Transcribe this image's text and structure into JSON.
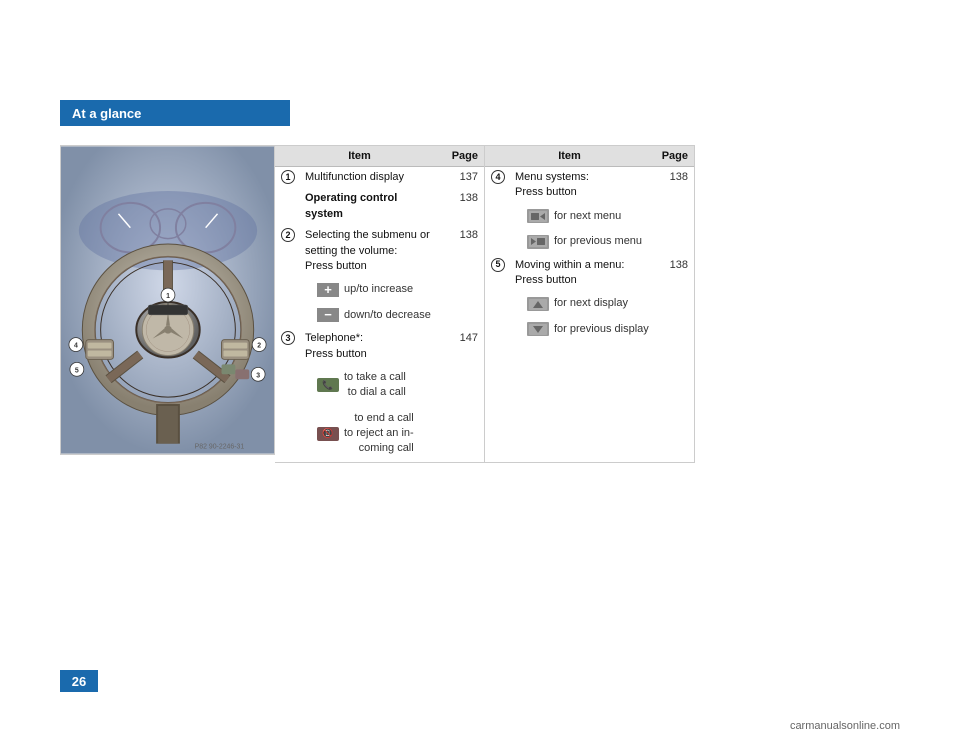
{
  "header": {
    "label": "At a glance"
  },
  "page_number": "26",
  "watermark": "carmanualsonline.com",
  "image_ref": "P82 90-2246-31",
  "left_table": {
    "col_item": "Item",
    "col_page": "Page",
    "rows": [
      {
        "num": "1",
        "label": "Multifunction display",
        "bold": false,
        "page": "137"
      },
      {
        "num": "",
        "label": "Operating control system",
        "bold": true,
        "page": "138"
      },
      {
        "num": "2",
        "label": "Selecting the submenu or setting the volume: Press button",
        "bold": false,
        "page": "138",
        "icons": [
          {
            "type": "plus",
            "label": "up/to increase"
          },
          {
            "type": "minus",
            "label": "down/to decrease"
          }
        ]
      },
      {
        "num": "3",
        "label": "Telephone*: Press button",
        "bold": false,
        "page": "147",
        "icons": [
          {
            "type": "phone-green",
            "label": "to take a call\nto dial a call"
          },
          {
            "type": "phone-red",
            "label": "to end a call\nto reject an in-\ncoming call"
          }
        ]
      }
    ]
  },
  "right_table": {
    "col_item": "Item",
    "col_page": "Page",
    "rows": [
      {
        "num": "4",
        "label": "Menu systems: Press button",
        "bold": false,
        "page": "138",
        "icons": [
          {
            "type": "menu-fwd",
            "label": "for next menu"
          },
          {
            "type": "menu-back",
            "label": "for previous menu"
          }
        ]
      },
      {
        "num": "5",
        "label": "Moving within a menu: Press button",
        "bold": false,
        "page": "138",
        "icons": [
          {
            "type": "nav-up",
            "label": "for next display"
          },
          {
            "type": "nav-down",
            "label": "for previous display"
          }
        ]
      }
    ]
  }
}
